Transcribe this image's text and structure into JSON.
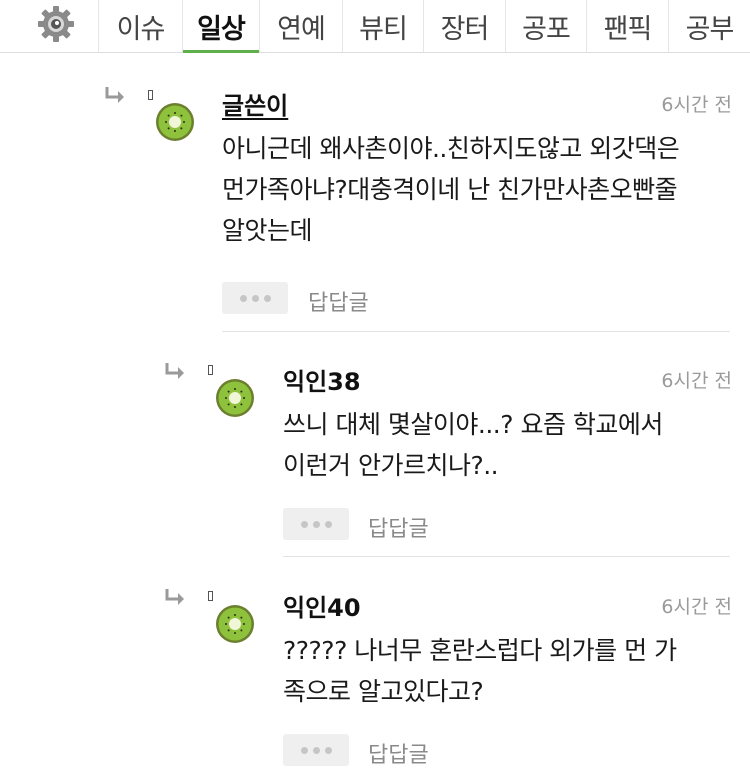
{
  "nav": {
    "settings_icon": "gear-icon",
    "tabs": [
      {
        "label": "이슈",
        "active": false
      },
      {
        "label": "일상",
        "active": true
      },
      {
        "label": "연예",
        "active": false
      },
      {
        "label": "뷰티",
        "active": false
      },
      {
        "label": "장터",
        "active": false
      },
      {
        "label": "공포",
        "active": false
      },
      {
        "label": "팬픽",
        "active": false
      },
      {
        "label": "공부",
        "active": false
      }
    ],
    "active_underline_color": "#5fb04b"
  },
  "comments": [
    {
      "author": "글쓴이",
      "is_op": true,
      "time": "6시간 전",
      "text": "아니근데 왜사촌이야..친하지도않고 외갓댁은\n먼가족아냐?대충격이네 난 친가만사촌오빤줄\n알앗는데",
      "reply_label": "답답글",
      "avatar_icon": "kiwi-avatar-icon"
    },
    {
      "author": "익인38",
      "is_op": false,
      "time": "6시간 전",
      "text": "쓰니 대체 몇살이야...? 요즘 학교에서\n이런거 안가르치나?..",
      "reply_label": "답답글",
      "avatar_icon": "kiwi-avatar-icon"
    },
    {
      "author": "익인40",
      "is_op": false,
      "time": "6시간 전",
      "text": "????? 나너무 혼란스럽다 외가를 먼 가\n족으로 알고있다고?",
      "reply_label": "답답글",
      "avatar_icon": "kiwi-avatar-icon"
    }
  ]
}
